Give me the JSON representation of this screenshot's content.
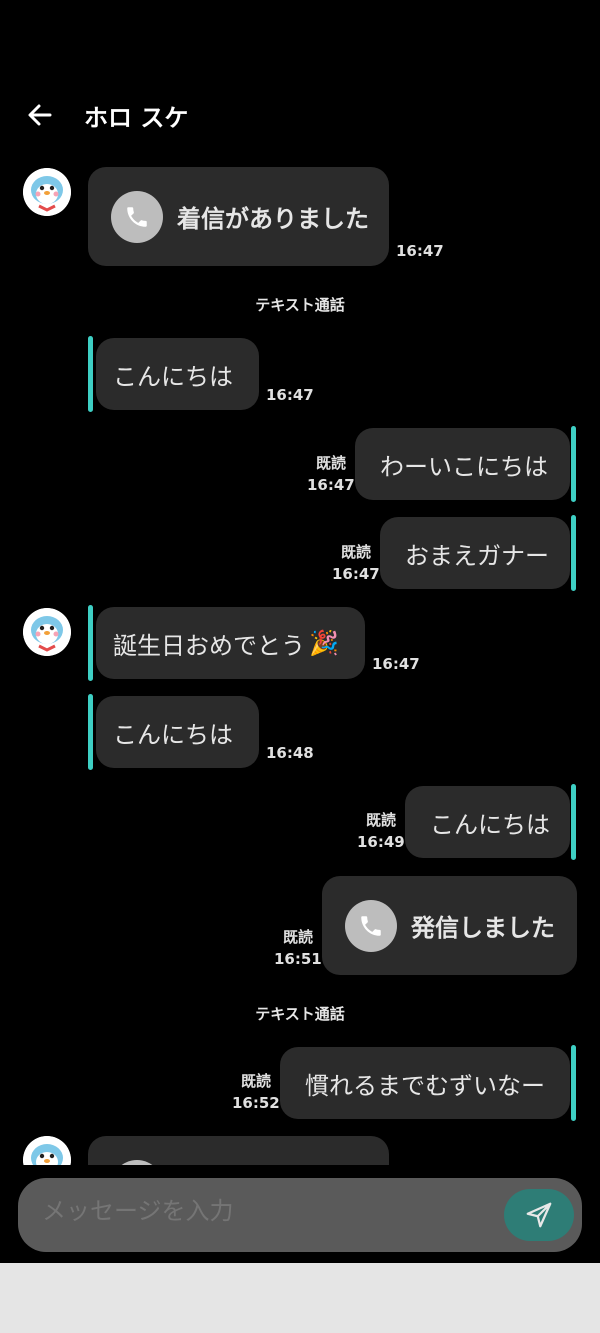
{
  "header": {
    "title": "ホロ スケ",
    "back_icon": "arrow-left-icon"
  },
  "messages": {
    "m1": {
      "text": "着信がありました",
      "time": "16:47",
      "icon": "phone-icon"
    },
    "s1": {
      "text": "テキスト通話"
    },
    "m2": {
      "text": "こんにちは",
      "time": "16:47"
    },
    "m3": {
      "text": "わーいこにちは",
      "read": "既読",
      "time": "16:47"
    },
    "m4": {
      "text": "おまえガナー",
      "read": "既読",
      "time": "16:47"
    },
    "m5": {
      "text": "誕生日おめでとう",
      "emoji": "🎉",
      "time": "16:47"
    },
    "m6": {
      "text": "こんにちは",
      "time": "16:48"
    },
    "m7": {
      "text": "こんにちは",
      "read": "既読",
      "time": "16:49"
    },
    "m8": {
      "text": "発信しました",
      "read": "既読",
      "time": "16:51",
      "icon": "phone-icon"
    },
    "s2": {
      "text": "テキスト通話"
    },
    "m9": {
      "text": "慣れるまでむずいなー",
      "read": "既読",
      "time": "16:52"
    }
  },
  "input": {
    "placeholder": "メッセージを入力",
    "send_icon": "send-icon"
  },
  "colors": {
    "accent": "#3ecfc4",
    "bubble": "#2b2b2b",
    "send": "#2e7d76",
    "background": "#000000"
  }
}
